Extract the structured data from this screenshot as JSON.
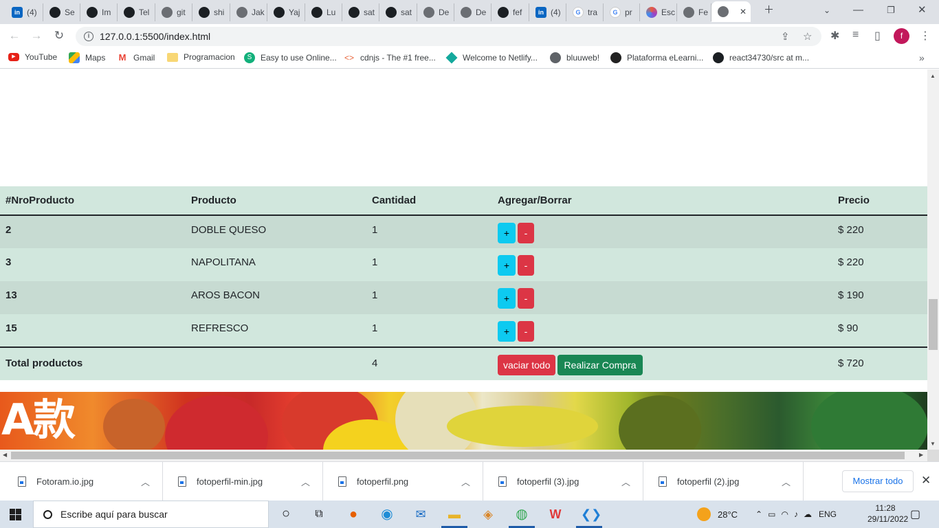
{
  "browser": {
    "tabs": [
      {
        "label": "(4)",
        "icon": "linkedin-icon"
      },
      {
        "label": "Se",
        "icon": "github-icon"
      },
      {
        "label": "Im",
        "icon": "github-icon"
      },
      {
        "label": "Tel",
        "icon": "github-icon"
      },
      {
        "label": "git",
        "icon": "globe-icon"
      },
      {
        "label": "shi",
        "icon": "github-icon"
      },
      {
        "label": "Jak",
        "icon": "globe-icon"
      },
      {
        "label": "Yaj",
        "icon": "github-icon"
      },
      {
        "label": "Lu",
        "icon": "github-icon"
      },
      {
        "label": "sat",
        "icon": "github-icon"
      },
      {
        "label": "sat",
        "icon": "github-icon"
      },
      {
        "label": "De",
        "icon": "globe-icon"
      },
      {
        "label": "De",
        "icon": "globe-icon"
      },
      {
        "label": "fef",
        "icon": "github-icon"
      },
      {
        "label": "(4)",
        "icon": "linkedin-icon"
      },
      {
        "label": "tra",
        "icon": "google-icon"
      },
      {
        "label": "pr",
        "icon": "google-icon"
      },
      {
        "label": "Esc",
        "icon": "edit-icon"
      },
      {
        "label": "Fe",
        "icon": "globe-icon"
      },
      {
        "label": "",
        "icon": "globe-icon",
        "active": true
      }
    ],
    "url": "127.0.0.1:5500/index.html",
    "profile_initial": "f",
    "bookmarks": [
      {
        "label": "YouTube",
        "icon": "youtube-icon"
      },
      {
        "label": "Maps",
        "icon": "maps-icon"
      },
      {
        "label": "Gmail",
        "icon": "gmail-icon"
      },
      {
        "label": "Programacion",
        "icon": "folder-icon"
      },
      {
        "label": "Easy to use Online...",
        "icon": "smallpdf-icon"
      },
      {
        "label": "cdnjs - The #1 free...",
        "icon": "code-icon"
      },
      {
        "label": "Welcome to Netlify...",
        "icon": "netlify-icon"
      },
      {
        "label": "bluuweb!",
        "icon": "globe-icon"
      },
      {
        "label": "Plataforma eLearni...",
        "icon": "elearning-icon"
      },
      {
        "label": "react34730/src at m...",
        "icon": "github-icon"
      }
    ]
  },
  "cart": {
    "headers": [
      "#NroProducto",
      "Producto",
      "Cantidad",
      "Agregar/Borrar",
      "Precio"
    ],
    "rows": [
      {
        "id": "2",
        "product": "DOBLE QUESO",
        "qty": "1",
        "price": "$ 220"
      },
      {
        "id": "3",
        "product": "NAPOLITANA",
        "qty": "1",
        "price": "$ 220"
      },
      {
        "id": "13",
        "product": "AROS BACON",
        "qty": "1",
        "price": "$ 190"
      },
      {
        "id": "15",
        "product": "REFRESCO",
        "qty": "1",
        "price": "$ 90"
      }
    ],
    "add_label": "+",
    "remove_label": "-",
    "footer": {
      "label": "Total productos",
      "qty": "4",
      "empty_label": "vaciar todo",
      "buy_label": "Realizar Compra",
      "total": "$ 720"
    },
    "colors": {
      "add": "#0dcaf0",
      "remove": "#dc3545",
      "buy": "#198754",
      "row": "#d1e7dd"
    }
  },
  "banner": {
    "text": "A款"
  },
  "downloads": {
    "files": [
      "Fotoram.io.jpg",
      "fotoperfil-min.jpg",
      "fotoperfil.png",
      "fotoperfil (3).jpg",
      "fotoperfil (2).jpg"
    ],
    "show_all": "Mostrar todo"
  },
  "taskbar": {
    "search_placeholder": "Escribe aquí para buscar",
    "weather": "28°C",
    "language": "ENG",
    "time": "11:28",
    "date": "29/11/2022"
  }
}
